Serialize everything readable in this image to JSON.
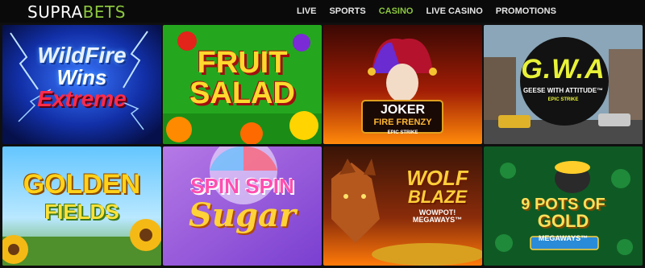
{
  "brand": {
    "part1": "SUPRA",
    "part2": "BETS",
    "accent": "#8cc63f"
  },
  "nav": [
    {
      "label": "LIVE",
      "active": false
    },
    {
      "label": "SPORTS",
      "active": false
    },
    {
      "label": "CASINO",
      "active": true
    },
    {
      "label": "LIVE CASINO",
      "active": false
    },
    {
      "label": "PROMOTIONS",
      "active": false
    }
  ],
  "games": [
    {
      "title": [
        "WildFire",
        "Wins",
        "Extreme"
      ],
      "theme": "blue-lightning"
    },
    {
      "title": [
        "FRUIT",
        "SALAD"
      ],
      "theme": "green-fruit"
    },
    {
      "title": [
        "JOKER",
        "FIRE FRENZY"
      ],
      "badge": "EPIC STRIKE",
      "theme": "joker-fire"
    },
    {
      "title": [
        "G.W.A"
      ],
      "subtitle": "GEESE WITH ATTITUDE™",
      "badge": "EPIC STRIKE",
      "theme": "street"
    },
    {
      "title": [
        "GOLDEN",
        "FIELDS"
      ],
      "theme": "sunflower"
    },
    {
      "title": [
        "SPIN SPIN",
        "Sugar"
      ],
      "theme": "candy"
    },
    {
      "title": [
        "WOLF",
        "BLAZE"
      ],
      "subtitle": "WOWPOT! MEGAWAYS™",
      "theme": "wolf"
    },
    {
      "title": [
        "9 POTS OF",
        "GOLD"
      ],
      "subtitle": "MEGAWAYS™",
      "theme": "clover"
    }
  ]
}
